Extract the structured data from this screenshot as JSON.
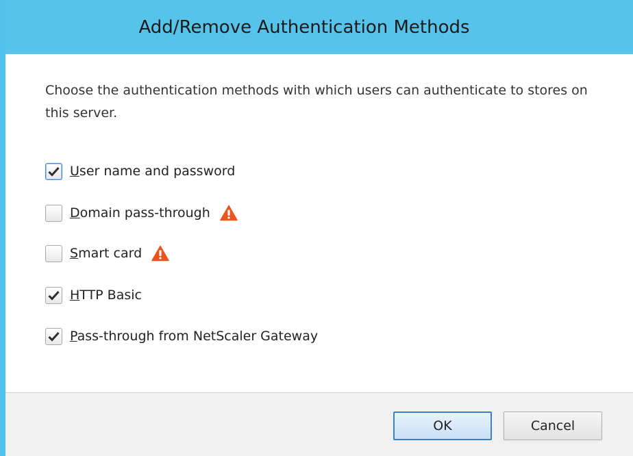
{
  "dialog": {
    "title": "Add/Remove Authentication Methods",
    "description": "Choose the authentication methods with which users can authenticate to stores on this server."
  },
  "options": [
    {
      "label": "User name and password",
      "checked": true,
      "warning": false
    },
    {
      "label": "Domain pass-through",
      "checked": false,
      "warning": true
    },
    {
      "label": "Smart card",
      "checked": false,
      "warning": true
    },
    {
      "label": "HTTP Basic",
      "checked": true,
      "warning": false
    },
    {
      "label": "Pass-through from NetScaler Gateway",
      "checked": true,
      "warning": false
    }
  ],
  "buttons": {
    "ok_label": "OK",
    "cancel_label": "Cancel"
  },
  "colors": {
    "title_bar": "#58c3ea",
    "warning": "#e8561e",
    "primary_button_border": "#3c7fc4"
  },
  "icons": {
    "checkmark": "checkmark-icon",
    "warning": "warning-icon"
  }
}
